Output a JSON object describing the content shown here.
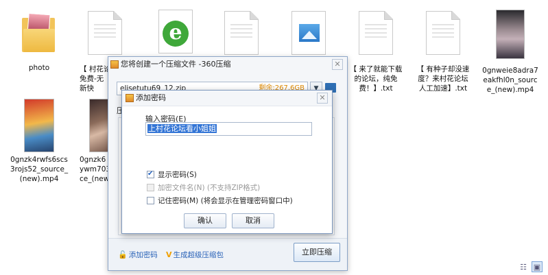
{
  "desktop": {
    "items": [
      {
        "label": "photo"
      },
      {
        "label": "【 村花论坛\n免费-无\n新快"
      },
      {
        "label": ""
      },
      {
        "label": ""
      },
      {
        "label": ""
      },
      {
        "label": "【 来了就能下载\n的论坛，纯免\n费！】.txt"
      },
      {
        "label": "【 有种子却没速\n度？来村花论坛\n人工加速】.txt"
      },
      {
        "label": "0gnweie8adra7\neakfhl0n_sourc\ne_(new).mp4"
      },
      {
        "label": "0gnzk4rwfs6scs\n3rojs52_source_\n(new).mp4"
      },
      {
        "label": "0gnzk6\nywm703\nce_(new"
      }
    ]
  },
  "main_dialog": {
    "title": "您将创建一个压缩文件 -360压缩",
    "close": "✕",
    "filename": "elisetutu69_12.zip",
    "remaining": "剩余:267.6GB",
    "dropdown": "▼",
    "compress_label": "压",
    "add_password_link": "添加密码",
    "super_compress_link": "生成超级压缩包",
    "compress_now_button": "立即压缩"
  },
  "password_dialog": {
    "title": "添加密码",
    "close": "✕",
    "input_label": "输入密码(E)",
    "password_value": "上村花论坛看小姐姐",
    "options": [
      {
        "label": "显示密码(S)",
        "checked": true,
        "enabled": true
      },
      {
        "label": "加密文件名(N) (不支持ZIP格式)",
        "checked": false,
        "enabled": false
      },
      {
        "label": "记住密码(M) (将会显示在管理密码窗口中)",
        "checked": false,
        "enabled": true
      }
    ],
    "ok_button": "确认",
    "cancel_button": "取消"
  },
  "view_icons": [
    "list-view",
    "large-icon-view"
  ]
}
